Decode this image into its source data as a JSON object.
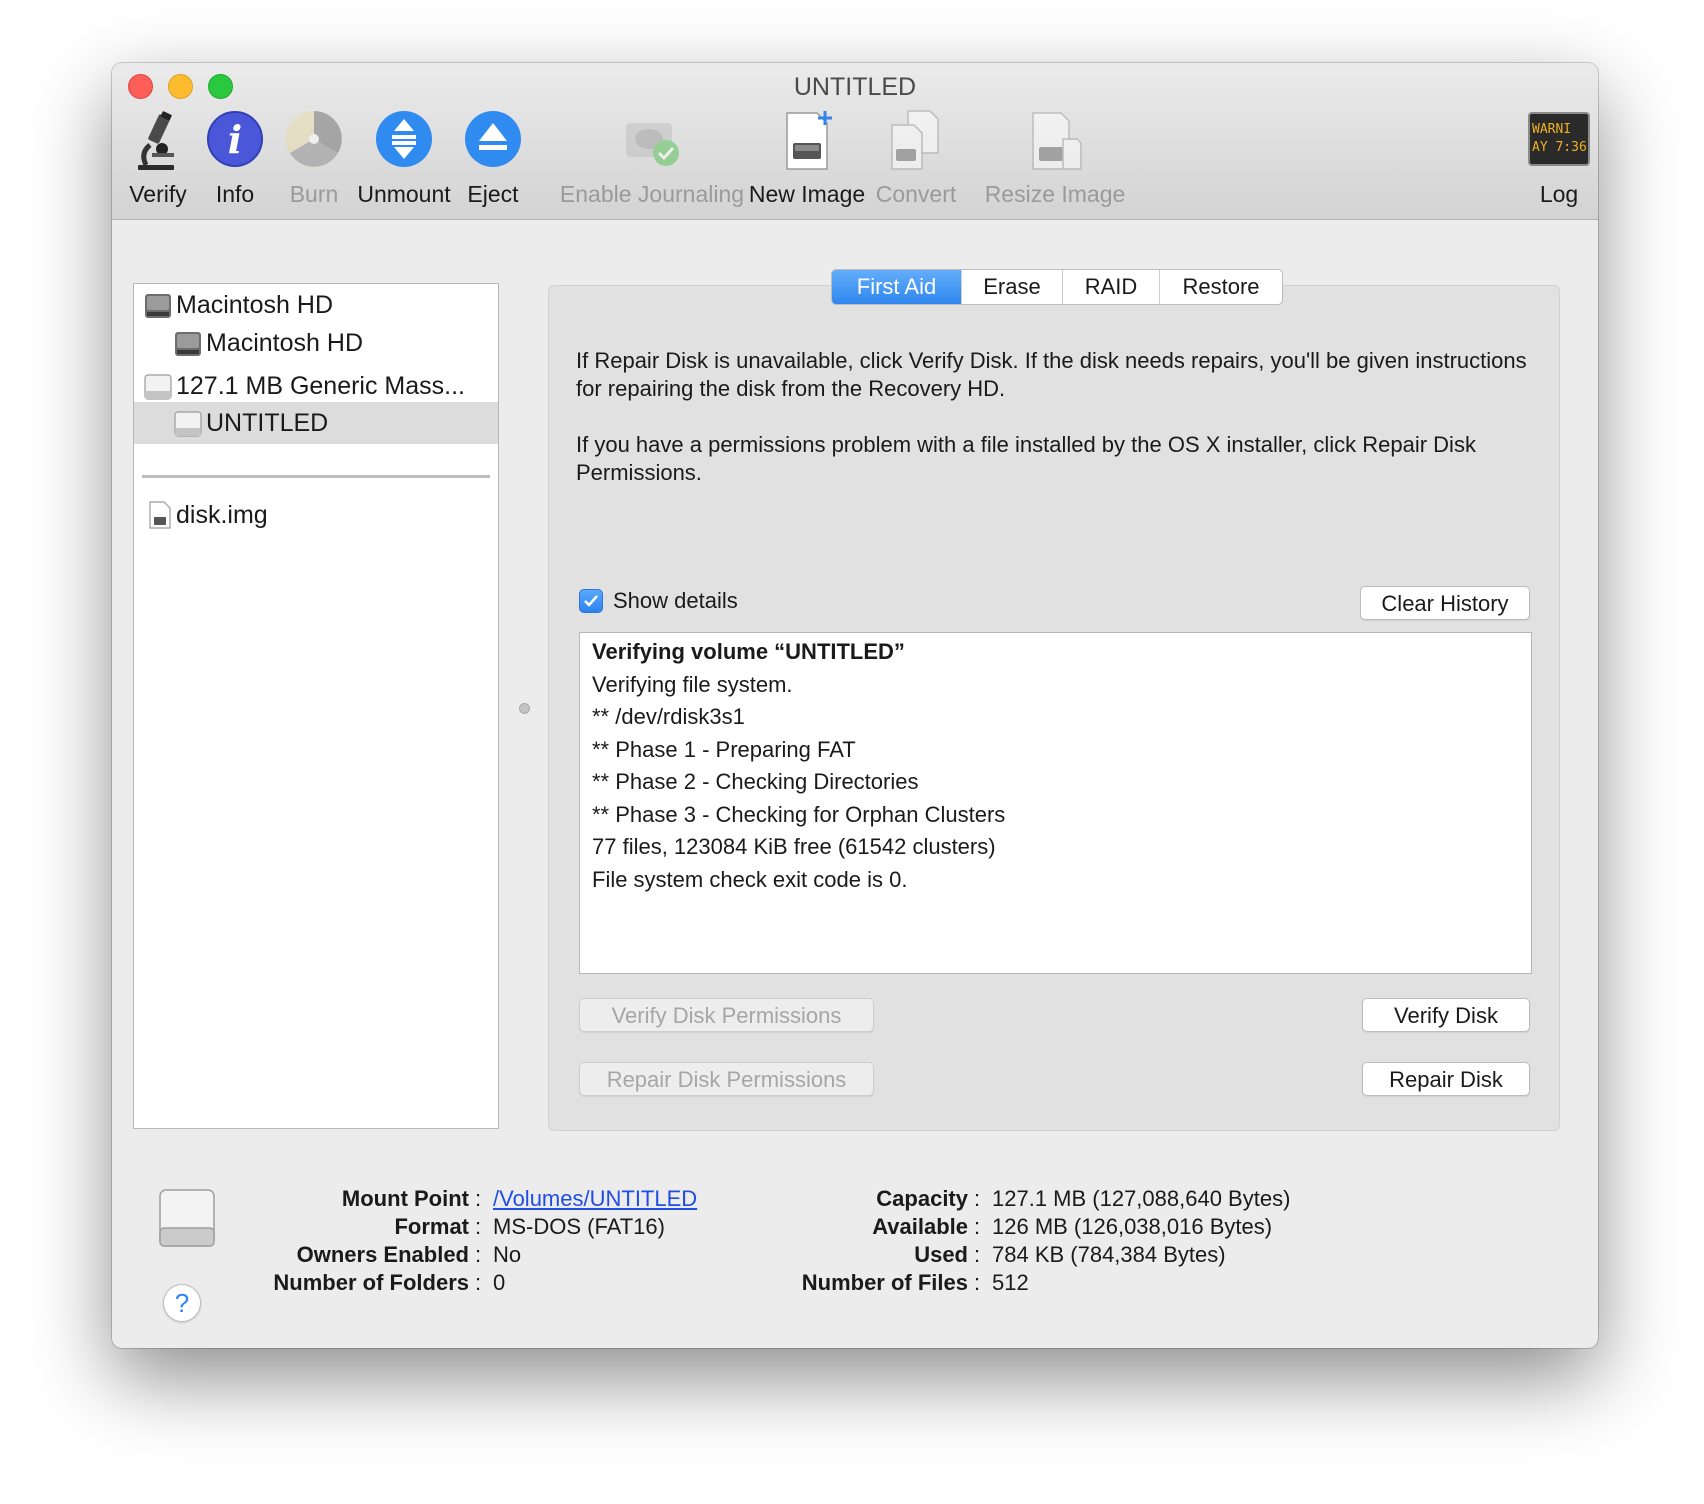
{
  "window": {
    "title": "UNTITLED"
  },
  "toolbar": {
    "verify": "Verify",
    "info": "Info",
    "burn": "Burn",
    "unmount": "Unmount",
    "eject": "Eject",
    "enable_journaling": "Enable Journaling",
    "new_image": "New Image",
    "convert": "Convert",
    "resize_image": "Resize Image",
    "log": "Log",
    "log_icon_text": [
      "WARNI",
      "AY 7:36"
    ]
  },
  "sidebar": {
    "items": [
      {
        "label": "Macintosh HD",
        "type": "internal-disk"
      },
      {
        "label": "Macintosh HD",
        "type": "internal-volume"
      },
      {
        "label": "127.1 MB Generic Mass...",
        "type": "external-disk"
      },
      {
        "label": "UNTITLED",
        "type": "external-volume",
        "selected": true
      },
      {
        "label": "disk.img",
        "type": "disk-image"
      }
    ]
  },
  "tabs": [
    "First Aid",
    "Erase",
    "RAID",
    "Restore"
  ],
  "active_tab": "First Aid",
  "first_aid": {
    "description_1": "If Repair Disk is unavailable, click Verify Disk. If the disk needs repairs, you'll be given instructions for repairing the disk from the Recovery HD.",
    "description_2": "If you have a permissions problem with a file installed by the OS X installer, click Repair Disk Permissions.",
    "show_details_label": "Show details",
    "show_details_checked": true,
    "clear_history_label": "Clear History",
    "log_lines": [
      "Verifying volume “UNTITLED”",
      "Verifying file system.",
      "** /dev/rdisk3s1",
      "** Phase 1 - Preparing FAT",
      "** Phase 2 - Checking Directories",
      "** Phase 3 - Checking for Orphan Clusters",
      "77 files, 123084 KiB free (61542 clusters)",
      "File system check exit code is 0."
    ],
    "verify_permissions_label": "Verify Disk Permissions",
    "repair_permissions_label": "Repair Disk Permissions",
    "verify_disk_label": "Verify Disk",
    "repair_disk_label": "Repair Disk"
  },
  "info": {
    "left": [
      {
        "key": "Mount Point",
        "value": "/Volumes/UNTITLED",
        "link": true
      },
      {
        "key": "Format",
        "value": "MS-DOS (FAT16)"
      },
      {
        "key": "Owners Enabled",
        "value": "No"
      },
      {
        "key": "Number of Folders",
        "value": "0"
      }
    ],
    "right": [
      {
        "key": "Capacity",
        "value": "127.1 MB (127,088,640 Bytes)"
      },
      {
        "key": "Available",
        "value": "126 MB (126,038,016 Bytes)"
      },
      {
        "key": "Used",
        "value": "784 KB (784,384 Bytes)"
      },
      {
        "key": "Number of Files",
        "value": "512"
      }
    ],
    "separator": ":",
    "help_label": "?"
  },
  "colors": {
    "accent": "#2f86ee",
    "link": "#1f4ee6",
    "close": "#fc5f57",
    "minimize": "#fdbc2e",
    "zoom": "#29c83e"
  }
}
